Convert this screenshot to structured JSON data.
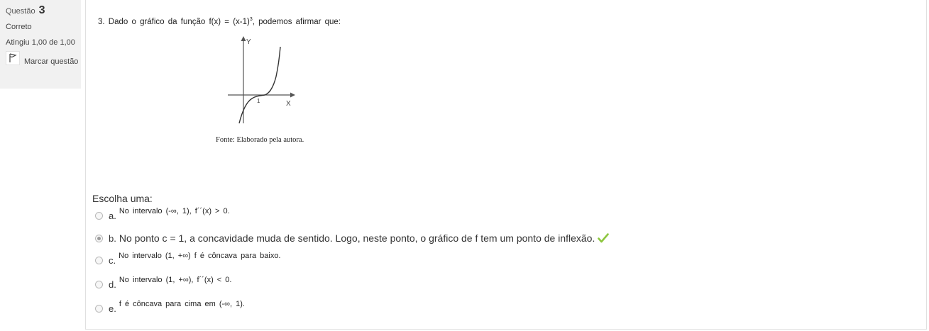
{
  "info": {
    "question_label": "Questão",
    "question_number": "3",
    "state": "Correto",
    "grade": "Atingiu 1,00 de 1,00",
    "flag_label": "Marcar questão"
  },
  "question": {
    "text_before": "3. Dado o gráfico da função f(x) = (x-1)",
    "superscript": "3",
    "text_after": ", podemos afirmar que:",
    "graph": {
      "y_label": "Y",
      "x_label": "X",
      "tick_label": "1"
    },
    "caption": "Fonte: Elaborado pela autora."
  },
  "prompt": "Escolha uma:",
  "options": [
    {
      "letter": "a.",
      "text": "No intervalo (-∞, 1), f´´(x) > 0.",
      "selected": false
    },
    {
      "letter": "b.",
      "text": "No ponto c = 1, a concavidade muda de sentido. Logo, neste ponto, o gráfico de f tem um ponto de inflexão.",
      "selected": true,
      "correct": true
    },
    {
      "letter": "c.",
      "text": "No intervalo (1, +∞) f é côncava para baixo.",
      "selected": false
    },
    {
      "letter": "d.",
      "text": "No intervalo (1, +∞), f´´(x) < 0.",
      "selected": false
    },
    {
      "letter": "e.",
      "text": "f é côncava para cima em (-∞, 1).",
      "selected": false
    }
  ],
  "colors": {
    "check": "#8dc63f",
    "info_bg": "#f1f1f1"
  }
}
